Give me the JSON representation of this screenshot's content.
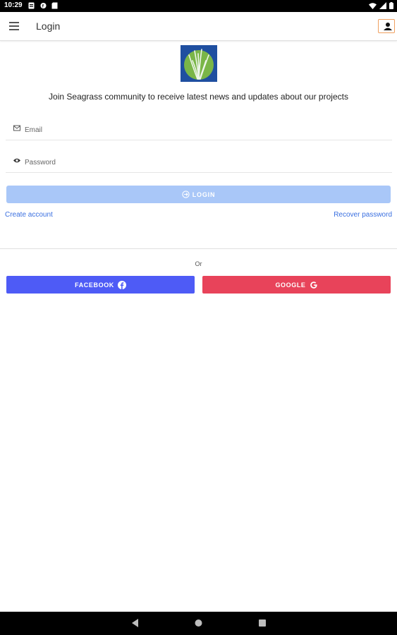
{
  "status_bar": {
    "time": "10:29"
  },
  "app_bar": {
    "title": "Login"
  },
  "tagline": "Join Seagrass community to receive latest news and updates about our projects",
  "form": {
    "email_placeholder": "Email",
    "email_value": "",
    "password_placeholder": "Password",
    "password_value": "",
    "login_label": "LOGIN"
  },
  "links": {
    "create_account": "Create account",
    "recover_password": "Recover password"
  },
  "divider_text": "Or",
  "social": {
    "facebook_label": "FACEBOOK",
    "google_label": "GOOGLE"
  },
  "colors": {
    "login_button": "#a9c7f8",
    "facebook": "#4e5bf6",
    "google": "#e8435a",
    "link": "#3a6fe0",
    "logo_bg": "#1f4fa0",
    "logo_circle": "#7ab648"
  },
  "icons": {
    "menu": "hamburger-menu-icon",
    "account": "account-box-icon",
    "email": "mail-icon",
    "password": "eye-icon",
    "login": "login-arrow-icon",
    "facebook": "facebook-icon",
    "google": "google-icon"
  }
}
